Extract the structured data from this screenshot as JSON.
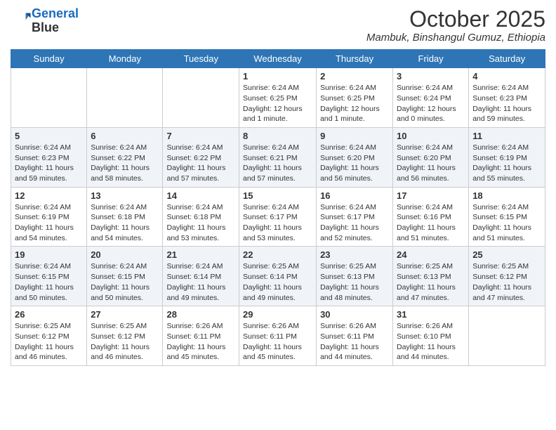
{
  "header": {
    "logo_line1": "General",
    "logo_line2": "Blue",
    "month_title": "October 2025",
    "location": "Mambuk, Binshangul Gumuz, Ethiopia"
  },
  "weekdays": [
    "Sunday",
    "Monday",
    "Tuesday",
    "Wednesday",
    "Thursday",
    "Friday",
    "Saturday"
  ],
  "weeks": [
    [
      {
        "day": "",
        "info": ""
      },
      {
        "day": "",
        "info": ""
      },
      {
        "day": "",
        "info": ""
      },
      {
        "day": "1",
        "info": "Sunrise: 6:24 AM\nSunset: 6:25 PM\nDaylight: 12 hours\nand 1 minute."
      },
      {
        "day": "2",
        "info": "Sunrise: 6:24 AM\nSunset: 6:25 PM\nDaylight: 12 hours\nand 1 minute."
      },
      {
        "day": "3",
        "info": "Sunrise: 6:24 AM\nSunset: 6:24 PM\nDaylight: 12 hours\nand 0 minutes."
      },
      {
        "day": "4",
        "info": "Sunrise: 6:24 AM\nSunset: 6:23 PM\nDaylight: 11 hours\nand 59 minutes."
      }
    ],
    [
      {
        "day": "5",
        "info": "Sunrise: 6:24 AM\nSunset: 6:23 PM\nDaylight: 11 hours\nand 59 minutes."
      },
      {
        "day": "6",
        "info": "Sunrise: 6:24 AM\nSunset: 6:22 PM\nDaylight: 11 hours\nand 58 minutes."
      },
      {
        "day": "7",
        "info": "Sunrise: 6:24 AM\nSunset: 6:22 PM\nDaylight: 11 hours\nand 57 minutes."
      },
      {
        "day": "8",
        "info": "Sunrise: 6:24 AM\nSunset: 6:21 PM\nDaylight: 11 hours\nand 57 minutes."
      },
      {
        "day": "9",
        "info": "Sunrise: 6:24 AM\nSunset: 6:20 PM\nDaylight: 11 hours\nand 56 minutes."
      },
      {
        "day": "10",
        "info": "Sunrise: 6:24 AM\nSunset: 6:20 PM\nDaylight: 11 hours\nand 56 minutes."
      },
      {
        "day": "11",
        "info": "Sunrise: 6:24 AM\nSunset: 6:19 PM\nDaylight: 11 hours\nand 55 minutes."
      }
    ],
    [
      {
        "day": "12",
        "info": "Sunrise: 6:24 AM\nSunset: 6:19 PM\nDaylight: 11 hours\nand 54 minutes."
      },
      {
        "day": "13",
        "info": "Sunrise: 6:24 AM\nSunset: 6:18 PM\nDaylight: 11 hours\nand 54 minutes."
      },
      {
        "day": "14",
        "info": "Sunrise: 6:24 AM\nSunset: 6:18 PM\nDaylight: 11 hours\nand 53 minutes."
      },
      {
        "day": "15",
        "info": "Sunrise: 6:24 AM\nSunset: 6:17 PM\nDaylight: 11 hours\nand 53 minutes."
      },
      {
        "day": "16",
        "info": "Sunrise: 6:24 AM\nSunset: 6:17 PM\nDaylight: 11 hours\nand 52 minutes."
      },
      {
        "day": "17",
        "info": "Sunrise: 6:24 AM\nSunset: 6:16 PM\nDaylight: 11 hours\nand 51 minutes."
      },
      {
        "day": "18",
        "info": "Sunrise: 6:24 AM\nSunset: 6:15 PM\nDaylight: 11 hours\nand 51 minutes."
      }
    ],
    [
      {
        "day": "19",
        "info": "Sunrise: 6:24 AM\nSunset: 6:15 PM\nDaylight: 11 hours\nand 50 minutes."
      },
      {
        "day": "20",
        "info": "Sunrise: 6:24 AM\nSunset: 6:15 PM\nDaylight: 11 hours\nand 50 minutes."
      },
      {
        "day": "21",
        "info": "Sunrise: 6:24 AM\nSunset: 6:14 PM\nDaylight: 11 hours\nand 49 minutes."
      },
      {
        "day": "22",
        "info": "Sunrise: 6:25 AM\nSunset: 6:14 PM\nDaylight: 11 hours\nand 49 minutes."
      },
      {
        "day": "23",
        "info": "Sunrise: 6:25 AM\nSunset: 6:13 PM\nDaylight: 11 hours\nand 48 minutes."
      },
      {
        "day": "24",
        "info": "Sunrise: 6:25 AM\nSunset: 6:13 PM\nDaylight: 11 hours\nand 47 minutes."
      },
      {
        "day": "25",
        "info": "Sunrise: 6:25 AM\nSunset: 6:12 PM\nDaylight: 11 hours\nand 47 minutes."
      }
    ],
    [
      {
        "day": "26",
        "info": "Sunrise: 6:25 AM\nSunset: 6:12 PM\nDaylight: 11 hours\nand 46 minutes."
      },
      {
        "day": "27",
        "info": "Sunrise: 6:25 AM\nSunset: 6:12 PM\nDaylight: 11 hours\nand 46 minutes."
      },
      {
        "day": "28",
        "info": "Sunrise: 6:26 AM\nSunset: 6:11 PM\nDaylight: 11 hours\nand 45 minutes."
      },
      {
        "day": "29",
        "info": "Sunrise: 6:26 AM\nSunset: 6:11 PM\nDaylight: 11 hours\nand 45 minutes."
      },
      {
        "day": "30",
        "info": "Sunrise: 6:26 AM\nSunset: 6:11 PM\nDaylight: 11 hours\nand 44 minutes."
      },
      {
        "day": "31",
        "info": "Sunrise: 6:26 AM\nSunset: 6:10 PM\nDaylight: 11 hours\nand 44 minutes."
      },
      {
        "day": "",
        "info": ""
      }
    ]
  ]
}
